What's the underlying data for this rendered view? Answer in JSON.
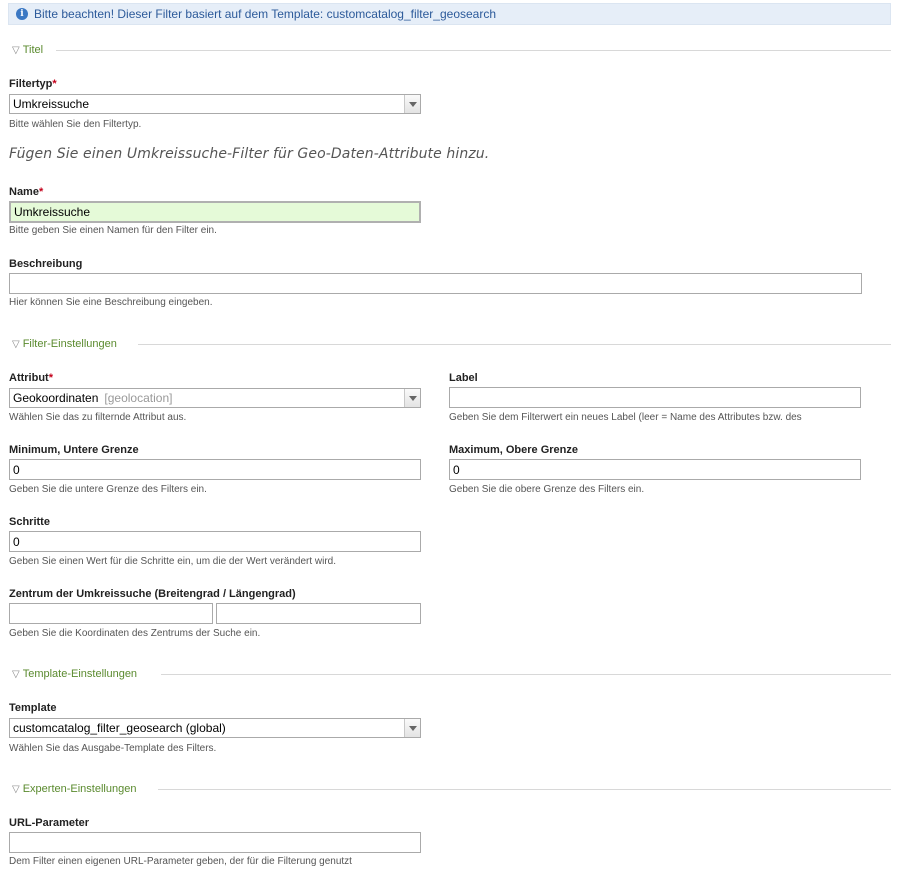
{
  "info": {
    "text": "Bitte beachten! Dieser Filter basiert auf dem Template: customcatalog_filter_geosearch"
  },
  "sections": {
    "titel": "Titel",
    "filter": "Filter-Einstellungen",
    "template": "Template-Einstellungen",
    "experten": "Experten-Einstellungen"
  },
  "filtertyp": {
    "label": "Filtertyp",
    "value": "Umkreissuche",
    "hint": "Bitte wählen Sie den Filtertyp."
  },
  "description_text": "Fügen Sie einen Umkreissuche-Filter für Geo-Daten-Attribute hinzu.",
  "name": {
    "label": "Name",
    "value": "Umkreissuche",
    "hint": "Bitte geben Sie einen Namen für den Filter ein."
  },
  "beschreibung": {
    "label": "Beschreibung",
    "value": "",
    "hint": "Hier können Sie eine Beschreibung eingeben."
  },
  "attribut": {
    "label": "Attribut",
    "value": "Geokoordinaten",
    "value_secondary": "[geolocation]",
    "hint": "Wählen Sie das zu filternde Attribut aus."
  },
  "label_field": {
    "label": "Label",
    "value": "",
    "hint": "Geben Sie dem Filterwert ein neues Label (leer = Name des Attributes bzw. des"
  },
  "minimum": {
    "label": "Minimum, Untere Grenze",
    "value": "0",
    "hint": "Geben Sie die untere Grenze des Filters ein."
  },
  "maximum": {
    "label": "Maximum, Obere Grenze",
    "value": "0",
    "hint": "Geben Sie die obere Grenze des Filters ein."
  },
  "schritte": {
    "label": "Schritte",
    "value": "0",
    "hint": "Geben Sie einen Wert für die Schritte ein, um die der Wert verändert wird."
  },
  "zentrum": {
    "label": "Zentrum der Umkreissuche (Breitengrad / Längengrad)",
    "lat": "",
    "lng": "",
    "hint": "Geben Sie die Koordinaten des Zentrums der Suche ein."
  },
  "template": {
    "label": "Template",
    "value": "customcatalog_filter_geosearch (global)",
    "hint": "Wählen Sie das Ausgabe-Template des Filters."
  },
  "url_param": {
    "label": "URL-Parameter",
    "value": "",
    "hint": "Dem Filter einen eigenen URL-Parameter geben, der für die Filterung genutzt"
  },
  "required_marker": "*",
  "colors": {
    "legend": "#5a8a2e",
    "required": "#c3001a",
    "active_field": "#e5fad8",
    "info_bg": "#e6eef8"
  }
}
